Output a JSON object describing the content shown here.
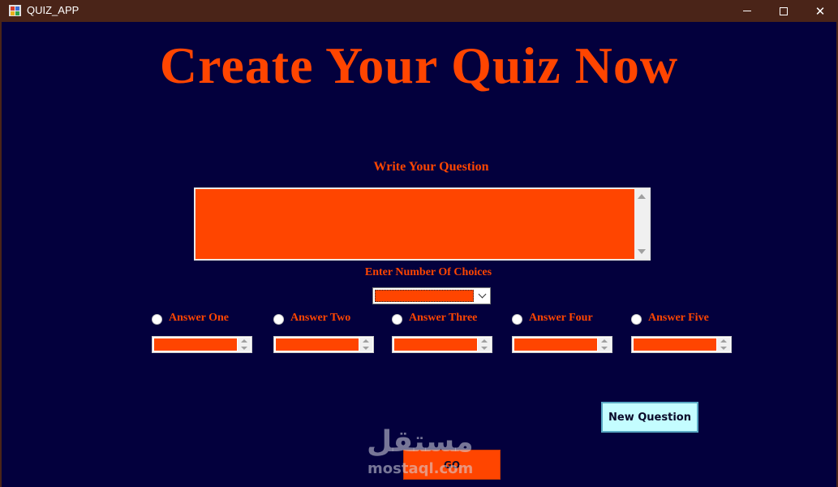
{
  "window": {
    "title": "QUIZ_APP",
    "close_glyph": "✕"
  },
  "heading": "Create Your Quiz Now",
  "question": {
    "label": "Write Your Question",
    "value": ""
  },
  "choices": {
    "label": "Enter Number Of Choices",
    "selected": ""
  },
  "answers": [
    {
      "label": "Answer One",
      "value": ""
    },
    {
      "label": "Answer Two",
      "value": ""
    },
    {
      "label": "Answer Three",
      "value": ""
    },
    {
      "label": "Answer Four",
      "value": ""
    },
    {
      "label": "Answer Five",
      "value": ""
    }
  ],
  "buttons": {
    "new_question": "New Question",
    "go": "GO"
  },
  "watermark": {
    "arabic": "مستقل",
    "latin": "mostaql.com"
  },
  "colors": {
    "accent": "#ff4500",
    "background": "#03003d",
    "titlebar": "#4a2418",
    "new_question_button": "#c4fdff"
  },
  "icons": [
    "app-icon",
    "minimize-icon",
    "maximize-icon",
    "close-icon",
    "chevron-down-icon"
  ]
}
